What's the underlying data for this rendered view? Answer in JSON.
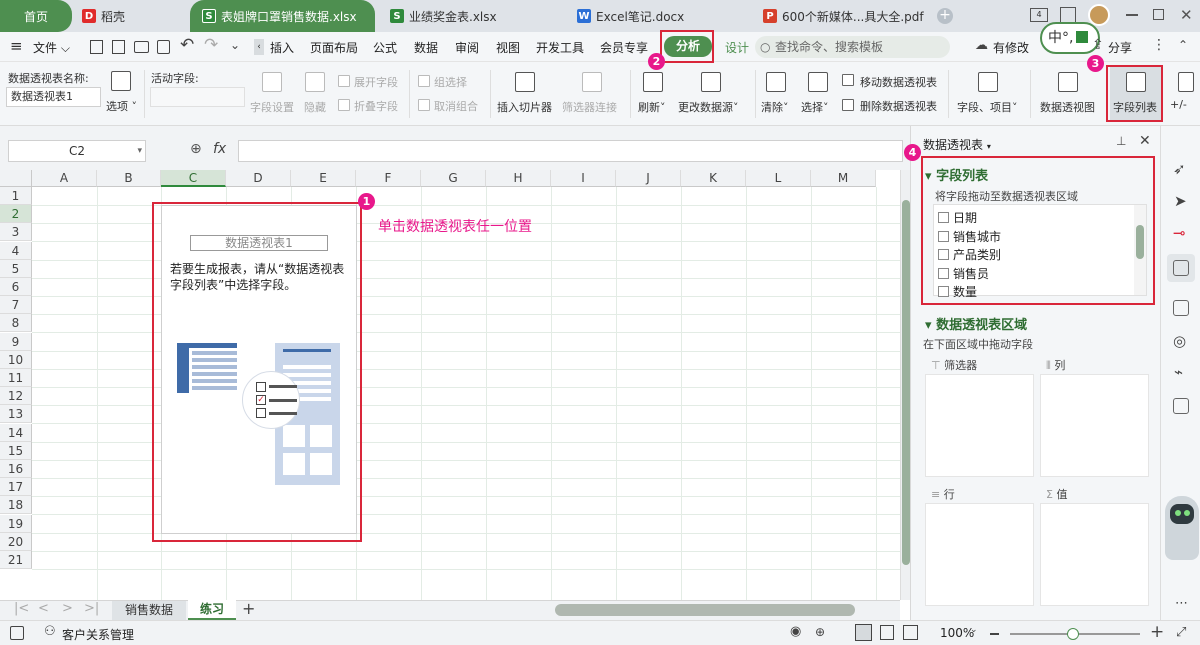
{
  "tabs": {
    "home": "首页",
    "daoke": "稻壳",
    "active": "表姐牌口罩销售数据.xlsx",
    "t2": "业绩奖金表.xlsx",
    "t3": "Excel笔记.docx",
    "t4": "600个新媒体...具大全.pdf"
  },
  "menu": {
    "file": "文件",
    "insert": "插入",
    "layout": "页面布局",
    "formula": "公式",
    "data": "数据",
    "review": "审阅",
    "view": "视图",
    "dev": "开发工具",
    "member": "会员专享",
    "analyze": "分析",
    "design": "设计",
    "search_placeholder": "查找命令、搜索模板",
    "modify": "有修改",
    "share": "分享"
  },
  "ribbon": {
    "pt_name_label": "数据透视表名称:",
    "pt_name_value": "数据透视表1",
    "options": "选项",
    "active_field": "活动字段:",
    "field_settings": "字段设置",
    "hide": "隐藏",
    "expand": "展开字段",
    "collapse": "折叠字段",
    "group": "组选择",
    "ungroup": "取消组合",
    "slicer": "插入切片器",
    "filter_conn": "筛选器连接",
    "refresh": "刷新",
    "change_source": "更改数据源",
    "clear": "清除",
    "select": "选择",
    "move_pt": "移动数据透视表",
    "delete_pt": "删除数据透视表",
    "fields_items": "字段、项目",
    "pivot_chart": "数据透视图",
    "field_list": "字段列表",
    "plusminus": "+/-"
  },
  "formula_bar": {
    "cell_ref": "C2",
    "fx": "fx"
  },
  "grid": {
    "columns": [
      "A",
      "B",
      "C",
      "D",
      "E",
      "F",
      "G",
      "H",
      "I",
      "J",
      "K",
      "L",
      "M"
    ],
    "rows": [
      "1",
      "2",
      "3",
      "4",
      "5",
      "6",
      "7",
      "8",
      "9",
      "10",
      "11",
      "12",
      "13",
      "14",
      "15",
      "16",
      "17",
      "18",
      "19",
      "20",
      "21"
    ]
  },
  "pivot": {
    "title": "数据透视表1",
    "hint": "若要生成报表，请从“数据透视表字段列表”中选择字段。"
  },
  "annotation": {
    "click_text": "单击数据透视表任一位置",
    "b1": "1",
    "b2": "2",
    "b3": "3",
    "b4": "4"
  },
  "sheets": {
    "s1": "销售数据",
    "s2": "练习"
  },
  "status": {
    "crm": "客户关系管理",
    "zoom": "100%"
  },
  "panel": {
    "title": "数据透视表",
    "field_list_title": "字段列表",
    "drag_hint": "将字段拖动至数据透视表区域",
    "fields": [
      "日期",
      "销售城市",
      "产品类别",
      "销售员",
      "数量"
    ],
    "area_title": "数据透视表区域",
    "area_hint": "在下面区域中拖动字段",
    "filter": "筛选器",
    "columns": "列",
    "rows": "行",
    "values": "值"
  },
  "ime": {
    "text": "中°,"
  },
  "colors": {
    "accent": "#4e8f50",
    "annotation": "#e8188b",
    "highlight": "#d9263a"
  }
}
